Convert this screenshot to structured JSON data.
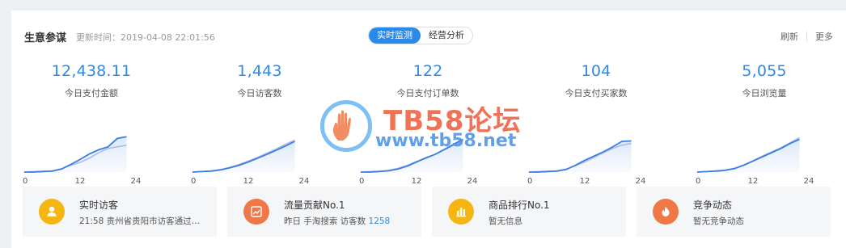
{
  "header": {
    "title": "生意参谋",
    "updated": "更新时间：2019-04-08 22:01:56",
    "tabs": [
      {
        "label": "实时监测",
        "active": true
      },
      {
        "label": "经营分析",
        "active": false
      }
    ],
    "refresh": "刷新",
    "more": "更多"
  },
  "metrics": [
    {
      "value": "12,438.11",
      "label": "今日支付金额"
    },
    {
      "value": "1,443",
      "label": "今日访客数"
    },
    {
      "value": "122",
      "label": "今日支付订单数"
    },
    {
      "value": "104",
      "label": "今日支付买家数"
    },
    {
      "value": "5,055",
      "label": "今日浏览量"
    }
  ],
  "chart_data": [
    {
      "type": "area",
      "x": [
        0,
        2,
        4,
        6,
        8,
        10,
        12,
        14,
        16,
        18,
        20,
        22
      ],
      "series": [
        {
          "values": [
            2,
            2,
            3,
            4,
            9,
            20,
            32,
            45,
            55,
            62,
            82,
            86
          ]
        },
        {
          "values": [
            2,
            3,
            4,
            5,
            10,
            18,
            25,
            35,
            48,
            58,
            62,
            66
          ]
        }
      ],
      "xticks": [
        "0",
        "12",
        "24"
      ],
      "xlim": [
        0,
        24
      ]
    },
    {
      "type": "area",
      "x": [
        0,
        2,
        4,
        6,
        8,
        10,
        12,
        14,
        16,
        18,
        20,
        22
      ],
      "series": [
        {
          "values": [
            2,
            3,
            4,
            7,
            12,
            18,
            26,
            35,
            44,
            54,
            64,
            75
          ]
        },
        {
          "values": [
            2,
            3,
            5,
            8,
            13,
            20,
            28,
            37,
            47,
            57,
            68,
            78
          ]
        }
      ],
      "xticks": [
        "0",
        "12",
        "24"
      ],
      "xlim": [
        0,
        24
      ]
    },
    {
      "type": "area",
      "x": [
        0,
        2,
        4,
        6,
        8,
        10,
        12,
        14,
        16,
        18,
        20,
        22
      ],
      "series": [
        {
          "values": [
            2,
            2,
            3,
            5,
            9,
            16,
            26,
            36,
            44,
            56,
            68,
            80
          ]
        },
        {
          "values": [
            2,
            3,
            4,
            6,
            11,
            18,
            27,
            34,
            44,
            55,
            66,
            76
          ]
        }
      ],
      "xticks": [
        "0",
        "12",
        "24"
      ],
      "xlim": [
        0,
        24
      ]
    },
    {
      "type": "area",
      "x": [
        0,
        2,
        4,
        6,
        8,
        10,
        12,
        14,
        16,
        18,
        20,
        22
      ],
      "series": [
        {
          "values": [
            2,
            2,
            3,
            4,
            8,
            18,
            30,
            40,
            50,
            62,
            75,
            76
          ]
        },
        {
          "values": [
            2,
            3,
            4,
            5,
            9,
            17,
            26,
            37,
            48,
            58,
            66,
            70
          ]
        }
      ],
      "xticks": [
        "0",
        "12",
        "24"
      ],
      "xlim": [
        0,
        24
      ]
    },
    {
      "type": "area",
      "x": [
        0,
        2,
        4,
        6,
        8,
        10,
        12,
        14,
        16,
        18,
        20,
        22
      ],
      "series": [
        {
          "values": [
            2,
            3,
            4,
            6,
            10,
            18,
            28,
            38,
            48,
            58,
            70,
            80
          ]
        },
        {
          "values": [
            2,
            3,
            5,
            7,
            11,
            19,
            29,
            40,
            50,
            60,
            72,
            84
          ]
        }
      ],
      "xticks": [
        "0",
        "12",
        "24"
      ],
      "xlim": [
        0,
        24
      ]
    }
  ],
  "cards": [
    {
      "title": "实时访客",
      "sub": "21:58 贵州省贵阳市访客通过…",
      "highlight": "",
      "icon": "user-icon",
      "color": "#f5b614"
    },
    {
      "title": "流量贡献No.1",
      "sub": "昨日 手淘搜索 访客数 ",
      "highlight": "1258",
      "icon": "trend-icon",
      "color": "#f07846"
    },
    {
      "title": "商品排行No.1",
      "sub": "暂无信息",
      "highlight": "",
      "icon": "bar-chart-icon",
      "color": "#f5b614"
    },
    {
      "title": "竞争动态",
      "sub": "暂无竞争动态",
      "highlight": "",
      "icon": "flame-icon",
      "color": "#f07846"
    }
  ],
  "watermark": {
    "line1": "TB58论坛",
    "line2": "www.tb58.net"
  },
  "colors": {
    "accent": "#2d8ae5",
    "line_main": "#3a7fe0",
    "line_compare": "#aab8e8"
  }
}
